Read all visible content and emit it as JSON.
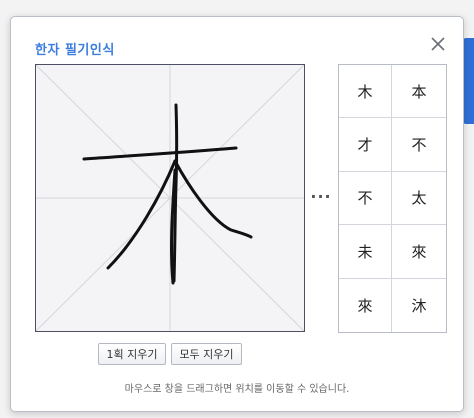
{
  "dialog": {
    "title": "한자 필기인식",
    "close_icon": "close-icon"
  },
  "canvas": {
    "guide": "diagonal-cross-guides",
    "drawn_character": "木"
  },
  "more_indicator": "···",
  "candidates": [
    "木",
    "本",
    "才",
    "不",
    "不",
    "太",
    "未",
    "來",
    "來",
    "沐"
  ],
  "buttons": {
    "undo_stroke": "1획 지우기",
    "clear_all": "모두 지우기"
  },
  "hint": "마우스로 창을 드래그하면 위치를 이동할 수 있습니다.",
  "colors": {
    "title": "#3b7de0",
    "canvas_border": "#4d5064",
    "canvas_bg": "#f4f4f6",
    "ink": "#111111",
    "accent": "#2f6fd6"
  }
}
